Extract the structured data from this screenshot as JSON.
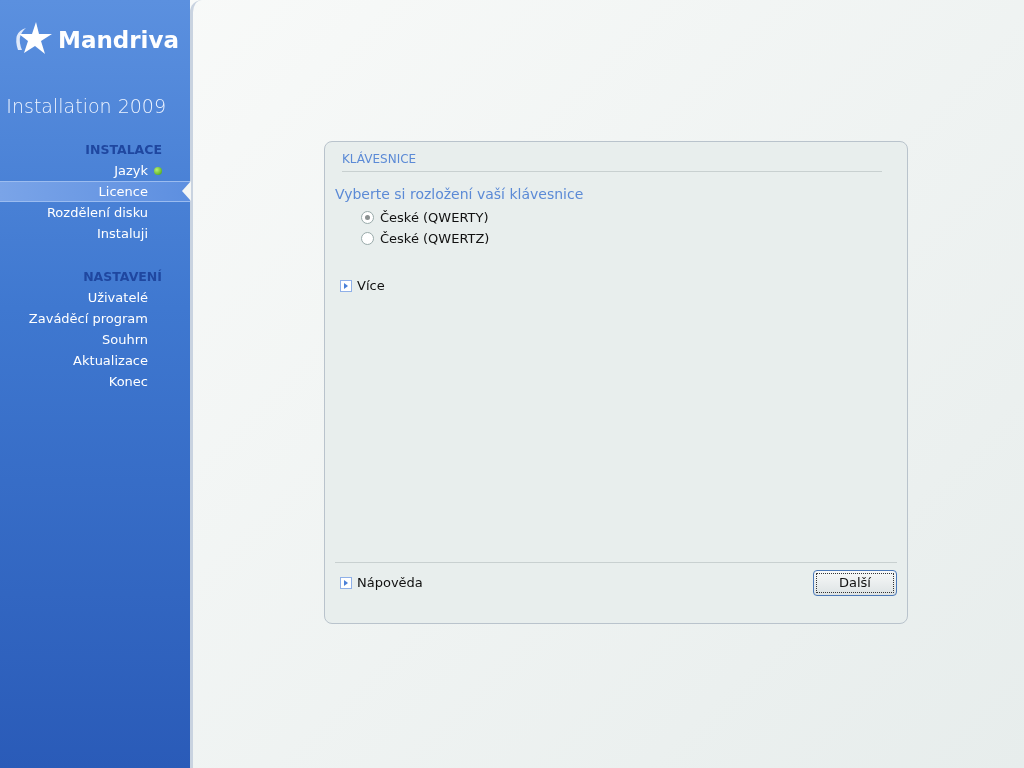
{
  "sidebar": {
    "logo_text": "Mandriva",
    "subtitle": "Installation 2009",
    "sections": [
      {
        "title": "INSTALACE",
        "items": [
          {
            "label": "Jazyk",
            "selected": false,
            "done": true
          },
          {
            "label": "Licence",
            "selected": true,
            "done": false
          },
          {
            "label": "Rozdělení disku",
            "selected": false,
            "done": false
          },
          {
            "label": "Instaluji",
            "selected": false,
            "done": false
          }
        ]
      },
      {
        "title": "NASTAVENÍ",
        "items": [
          {
            "label": "Uživatelé",
            "selected": false,
            "done": false
          },
          {
            "label": "Zaváděcí program",
            "selected": false,
            "done": false
          },
          {
            "label": "Souhrn",
            "selected": false,
            "done": false
          },
          {
            "label": "Aktualizace",
            "selected": false,
            "done": false
          },
          {
            "label": "Konec",
            "selected": false,
            "done": false
          }
        ]
      }
    ]
  },
  "dialog": {
    "title": "KLÁVESNICE",
    "prompt": "Vyberte si rozložení vaší klávesnice",
    "options": [
      {
        "label": "České (QWERTY)",
        "selected": true
      },
      {
        "label": "České (QWERTZ)",
        "selected": false
      }
    ],
    "more": {
      "label": "Více",
      "expanded": false
    },
    "help": {
      "label": "Nápověda",
      "expanded": false
    },
    "next_button": "Další"
  }
}
